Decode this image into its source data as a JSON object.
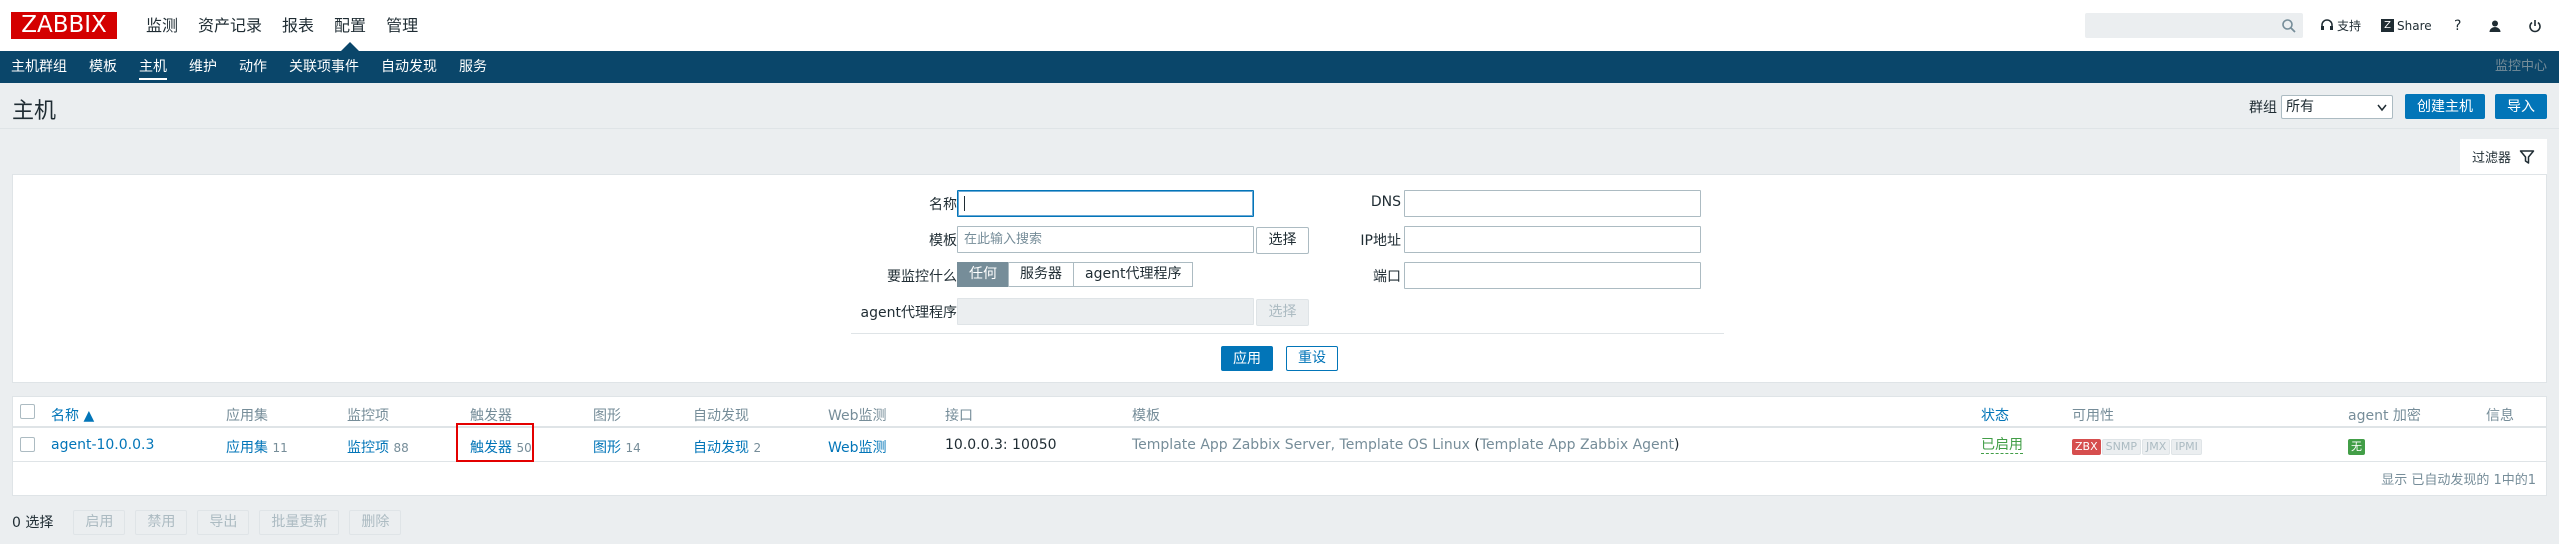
{
  "app": {
    "logo": "ZABBIX"
  },
  "main_menu": [
    "监测",
    "资产记录",
    "报表",
    "配置",
    "管理"
  ],
  "main_menu_active": "配置",
  "top_right": {
    "support": "支持",
    "share": "Share",
    "help": "?"
  },
  "sub_menu": [
    "主机群组",
    "模板",
    "主机",
    "维护",
    "动作",
    "关联项事件",
    "自动发现",
    "服务"
  ],
  "sub_menu_active": "主机",
  "sub_bar_right": "监控中心",
  "page": {
    "title": "主机",
    "group_label": "群组",
    "group_value": "所有",
    "create_button": "创建主机",
    "import_button": "导入"
  },
  "filter": {
    "tab_label": "过滤器",
    "name_label": "名称",
    "template_label": "模板",
    "template_placeholder": "在此输入搜索",
    "select_button": "选择",
    "monitored_label": "要监控什么",
    "monitored_options": [
      "任何",
      "服务器",
      "agent代理程序"
    ],
    "monitored_selected": "任何",
    "proxy_label": "agent代理程序",
    "dns_label": "DNS",
    "ip_label": "IP地址",
    "port_label": "端口",
    "apply_button": "应用",
    "reset_button": "重设"
  },
  "table": {
    "headers": {
      "name": "名称 ▲",
      "applications": "应用集",
      "items": "监控项",
      "triggers": "触发器",
      "graphs": "图形",
      "discovery": "自动发现",
      "web": "Web监测",
      "interface": "接口",
      "templates": "模板",
      "status": "状态",
      "availability": "可用性",
      "encryption": "agent 加密",
      "info": "信息"
    },
    "rows": [
      {
        "name": "agent-10.0.0.3",
        "applications": "应用集",
        "applications_count": "11",
        "items": "监控项",
        "items_count": "88",
        "triggers": "触发器",
        "triggers_count": "50",
        "graphs": "图形",
        "graphs_count": "14",
        "discovery": "自动发现",
        "discovery_count": "2",
        "web": "Web监测",
        "interface": "10.0.0.3: 10050",
        "template_1": "Template App Zabbix Server",
        "template_sep": ",",
        "template_2": "Template OS Linux",
        "template_paren_open": "(",
        "template_3": "Template App Zabbix Agent",
        "template_paren_close": ")",
        "status": "已启用",
        "availability": [
          "ZBX",
          "SNMP",
          "JMX",
          "IPMI"
        ],
        "encryption": "无"
      }
    ],
    "footer": "显示 已自动发现的 1中的1"
  },
  "bottom": {
    "selected": "0 选择",
    "buttons": [
      "启用",
      "禁用",
      "导出",
      "批量更新",
      "删除"
    ]
  },
  "colors": {
    "brand": "#d40000",
    "nav_dark": "#0a466a",
    "link": "#0275b8",
    "enabled": "#429e47",
    "highlight": "#e30000"
  }
}
